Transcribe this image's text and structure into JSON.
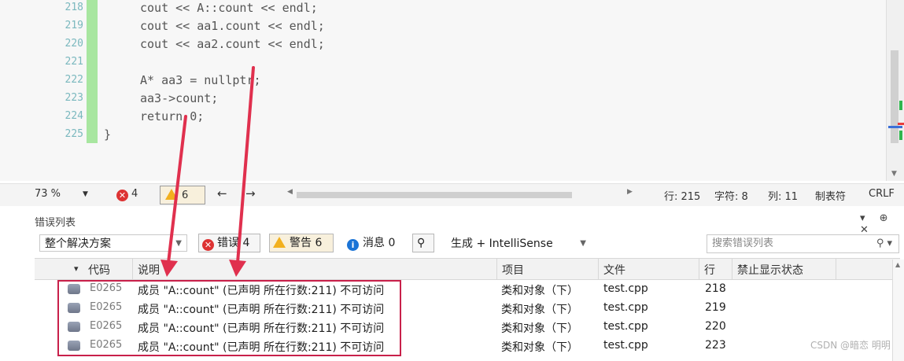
{
  "editor": {
    "line_numbers": [
      "218",
      "219",
      "220",
      "221",
      "222",
      "223",
      "224",
      "225"
    ],
    "lines": [
      {
        "kind": "plain",
        "text": "cout << A::count << endl;"
      },
      {
        "kind": "plain",
        "text": "cout << aa1.count << endl;"
      },
      {
        "kind": "plain",
        "text": "cout << aa2.count << endl;"
      },
      {
        "kind": "plain",
        "text": ""
      },
      {
        "kind": "plain",
        "text": "A* aa3 = nullptr;"
      },
      {
        "kind": "plain",
        "text": "aa3->count;"
      },
      {
        "kind": "plain",
        "text": "return 0;"
      },
      {
        "kind": "plain",
        "text": "}"
      }
    ]
  },
  "status": {
    "zoom": "73 %",
    "errors": "4",
    "warnings": "6",
    "line": "行: 215",
    "char": "字符: 8",
    "col": "列: 11",
    "tab": "制表符",
    "eol": "CRLF"
  },
  "panel": {
    "title": "错误列表",
    "controls": "▾ ⊕ ✕",
    "scope": "整个解决方案",
    "errors_btn": "错误 4",
    "warnings_btn": "警告 6",
    "messages_btn": "消息 0",
    "build_filter": "生成 + IntelliSense",
    "search_placeholder": "搜索错误列表",
    "columns": {
      "code": "代码",
      "desc": "说明",
      "project": "项目",
      "file": "文件",
      "line": "行",
      "suppress": "禁止显示状态"
    },
    "rows": [
      {
        "code": "E0265",
        "desc": "成员 \"A::count\" (已声明 所在行数:211) 不可访问",
        "project": "类和对象（下）",
        "file": "test.cpp",
        "line": "218"
      },
      {
        "code": "E0265",
        "desc": "成员 \"A::count\" (已声明 所在行数:211) 不可访问",
        "project": "类和对象（下）",
        "file": "test.cpp",
        "line": "219"
      },
      {
        "code": "E0265",
        "desc": "成员 \"A::count\" (已声明 所在行数:211) 不可访问",
        "project": "类和对象（下）",
        "file": "test.cpp",
        "line": "220"
      },
      {
        "code": "E0265",
        "desc": "成员 \"A::count\" (已声明 所在行数:211) 不可访问",
        "project": "类和对象（下）",
        "file": "test.cpp",
        "line": "223"
      }
    ]
  },
  "watermark": "CSDN @暗恋 明明",
  "colors": {
    "error": "#d33333",
    "warning": "#f2b01e",
    "info": "#1b74d6",
    "annotation": "#e0304e",
    "change_bar": "#a8e6a0"
  }
}
